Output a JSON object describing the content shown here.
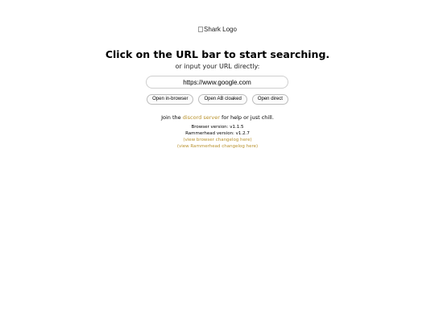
{
  "logo": {
    "alt_text": "Shark Logo"
  },
  "title": "Click on the URL bar to start searching.",
  "subtitle": "or input your URL directly:",
  "url_input": {
    "value": "https://www.google.com"
  },
  "buttons": {
    "open_in_browser": "Open in-browser",
    "open_ab_cloaked": "Open AB cloaked",
    "open_direct": "Open direct"
  },
  "join": {
    "prefix": "Join the ",
    "link_text": "discord server",
    "suffix": " for help or just chill."
  },
  "versions": {
    "browser_version": "Browser version: v1.1.5",
    "rammerhead_version": "Rammerhead version: v1.2.7",
    "browser_changelog_link": "(view browser changelog here)",
    "rammerhead_changelog_link": "(view Rammerhead changelog here)"
  },
  "colors": {
    "link": "#b8912b",
    "background": "#ffffff",
    "text": "#000000"
  }
}
